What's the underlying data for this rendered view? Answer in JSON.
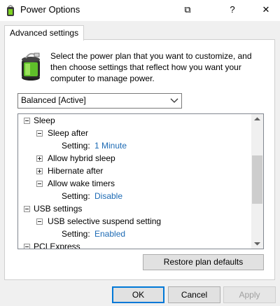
{
  "window": {
    "title": "Power Options",
    "restore_glyph": "⧉",
    "help_glyph": "?",
    "close_glyph": "✕"
  },
  "tab": {
    "label": "Advanced settings"
  },
  "description": "Select the power plan that you want to customize, and then choose settings that reflect how you want your computer to manage power.",
  "plan_select": {
    "value": "Balanced [Active]"
  },
  "tree": {
    "sleep": "Sleep",
    "sleep_after": "Sleep after",
    "sleep_after_setting_label": "Setting:",
    "sleep_after_setting_value": "1 Minute",
    "allow_hybrid_sleep": "Allow hybrid sleep",
    "hibernate_after": "Hibernate after",
    "allow_wake_timers": "Allow wake timers",
    "wake_timers_setting_label": "Setting:",
    "wake_timers_setting_value": "Disable",
    "usb_settings": "USB settings",
    "usb_selective_suspend": "USB selective suspend setting",
    "usb_setting_label": "Setting:",
    "usb_setting_value": "Enabled",
    "pci_express": "PCI Express"
  },
  "buttons": {
    "restore": "Restore plan defaults",
    "ok": "OK",
    "cancel": "Cancel",
    "apply": "Apply"
  },
  "colors": {
    "link": "#1c6ab4",
    "ok_border": "#0078d7"
  }
}
